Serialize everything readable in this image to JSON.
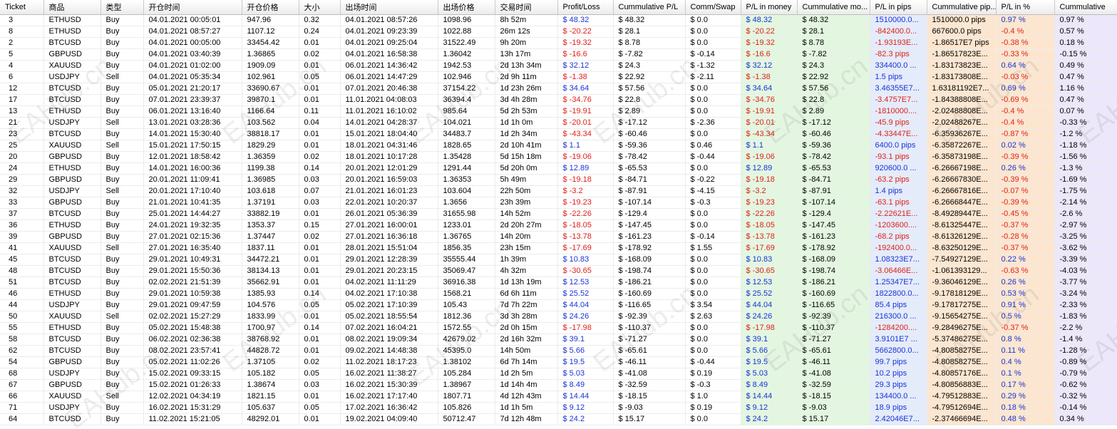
{
  "columns": [
    "Ticket",
    "商品",
    "类型",
    "开仓时间",
    "开仓价格",
    "大小",
    "出场时间",
    "出场价格",
    "交易时间",
    "Profit/Loss",
    "Cummulative P/L",
    "Comm/Swap",
    "P/L in money",
    "Cummulative mo...",
    "P/L in pips",
    "Cummulative pip...",
    "P/L in %",
    "Cummulative"
  ],
  "watermark": "EAHub.cn",
  "rows": [
    [
      "3",
      "ETHUSD",
      "Buy",
      "04.01.2021 00:05:01",
      "947.96",
      "0.32",
      "04.01.2021 08:57:26",
      "1098.96",
      "8h 52m",
      "$ 48.32",
      "$ 48.32",
      "$ 0.0",
      "$ 48.32",
      "$ 48.32",
      "1510000.0...",
      "1510000.0 pips",
      "0.97 %",
      "0.97 %"
    ],
    [
      "8",
      "ETHUSD",
      "Buy",
      "04.01.2021 08:57:27",
      "1107.12",
      "0.24",
      "04.01.2021 09:23:39",
      "1022.88",
      "26m 12s",
      "$ -20.22",
      "$ 28.1",
      "$ 0.0",
      "$ -20.22",
      "$ 28.1",
      "-842400.0...",
      "667600.0 pips",
      "-0.4 %",
      "0.57 %"
    ],
    [
      "2",
      "BTCUSD",
      "Buy",
      "04.01.2021 00:05:00",
      "33454.42",
      "0.01",
      "04.01.2021 09:25:04",
      "31522.49",
      "9h 20m",
      "$ -19.32",
      "$ 8.78",
      "$ 0.0",
      "$ -19.32",
      "$ 8.78",
      "-1.93193E...",
      "-1.86517E7 pips",
      "-0.38 %",
      "0.18 %"
    ],
    [
      "5",
      "GBPUSD",
      "Buy",
      "04.01.2021 03:40:39",
      "1.36865",
      "0.02",
      "04.01.2021 16:58:38",
      "1.36042",
      "13h 17m",
      "$ -16.6",
      "$ -7.82",
      "$ -0.14",
      "$ -16.6",
      "$ -7.82",
      "-82.3 pips",
      "-1.86517823E...",
      "-0.33 %",
      "-0.15 %"
    ],
    [
      "4",
      "XAUUSD",
      "Buy",
      "04.01.2021 01:02:00",
      "1909.09",
      "0.01",
      "06.01.2021 14:36:42",
      "1942.53",
      "2d 13h 34m",
      "$ 32.12",
      "$ 24.3",
      "$ -1.32",
      "$ 32.12",
      "$ 24.3",
      "334400.0 ...",
      "-1.83173823E...",
      "0.64 %",
      "0.49 %"
    ],
    [
      "6",
      "USDJPY",
      "Sell",
      "04.01.2021 05:35:34",
      "102.961",
      "0.05",
      "06.01.2021 14:47:29",
      "102.946",
      "2d 9h 11m",
      "$ -1.38",
      "$ 22.92",
      "$ -2.11",
      "$ -1.38",
      "$ 22.92",
      "1.5 pips",
      "-1.83173808E...",
      "-0.03 %",
      "0.47 %"
    ],
    [
      "12",
      "BTCUSD",
      "Buy",
      "05.01.2021 21:20:17",
      "33690.67",
      "0.01",
      "07.01.2021 20:46:38",
      "37154.22",
      "1d 23h 26m",
      "$ 34.64",
      "$ 57.56",
      "$ 0.0",
      "$ 34.64",
      "$ 57.56",
      "3.46355E7...",
      "1.63181192E7...",
      "0.69 %",
      "1.16 %"
    ],
    [
      "17",
      "BTCUSD",
      "Buy",
      "07.01.2021 23:39:37",
      "39870.1",
      "0.01",
      "11.01.2021 04:08:03",
      "36394.4",
      "3d 4h 28m",
      "$ -34.76",
      "$ 22.8",
      "$ 0.0",
      "$ -34.76",
      "$ 22.8",
      "-3.4757E7...",
      "-1.84388808E...",
      "-0.69 %",
      "0.47 %"
    ],
    [
      "13",
      "ETHUSD",
      "Buy",
      "06.01.2021 13:16:40",
      "1166.64",
      "0.11",
      "11.01.2021 16:10:02",
      "985.64",
      "5d 2h 53m",
      "$ -19.91",
      "$ 2.89",
      "$ 0.0",
      "$ -19.91",
      "$ 2.89",
      "-1810000....",
      "-2.02488808E...",
      "-0.4 %",
      "0.07 %"
    ],
    [
      "21",
      "USDJPY",
      "Sell",
      "13.01.2021 03:28:36",
      "103.562",
      "0.04",
      "14.01.2021 04:28:37",
      "104.021",
      "1d 1h 0m",
      "$ -20.01",
      "$ -17.12",
      "$ -2.36",
      "$ -20.01",
      "$ -17.12",
      "-45.9 pips",
      "-2.02488267E...",
      "-0.4 %",
      "-0.33 %"
    ],
    [
      "23",
      "BTCUSD",
      "Buy",
      "14.01.2021 15:30:40",
      "38818.17",
      "0.01",
      "15.01.2021 18:04:40",
      "34483.7",
      "1d 2h 34m",
      "$ -43.34",
      "$ -60.46",
      "$ 0.0",
      "$ -43.34",
      "$ -60.46",
      "-4.33447E...",
      "-6.35936267E...",
      "-0.87 %",
      "-1.2 %"
    ],
    [
      "25",
      "XAUUSD",
      "Sell",
      "15.01.2021 17:50:15",
      "1829.29",
      "0.01",
      "18.01.2021 04:31:46",
      "1828.65",
      "2d 10h 41m",
      "$ 1.1",
      "$ -59.36",
      "$ 0.46",
      "$ 1.1",
      "$ -59.36",
      "6400.0 pips",
      "-6.35872267E...",
      "0.02 %",
      "-1.18 %"
    ],
    [
      "20",
      "GBPUSD",
      "Buy",
      "12.01.2021 18:58:42",
      "1.36359",
      "0.02",
      "18.01.2021 10:17:28",
      "1.35428",
      "5d 15h 18m",
      "$ -19.06",
      "$ -78.42",
      "$ -0.44",
      "$ -19.06",
      "$ -78.42",
      "-93.1 pips",
      "-6.35873198E...",
      "-0.39 %",
      "-1.56 %"
    ],
    [
      "24",
      "ETHUSD",
      "Buy",
      "14.01.2021 16:00:36",
      "1199.38",
      "0.14",
      "20.01.2021 12:01:29",
      "1291.44",
      "5d 20h 0m",
      "$ 12.89",
      "$ -65.53",
      "$ 0.0",
      "$ 12.89",
      "$ -65.53",
      "920600.0 ...",
      "-6.26667198E...",
      "0.26 %",
      "-1.3 %"
    ],
    [
      "29",
      "GBPUSD",
      "Buy",
      "20.01.2021 11:09:41",
      "1.36985",
      "0.03",
      "20.01.2021 16:59:03",
      "1.36353",
      "5h 49m",
      "$ -19.18",
      "$ -84.71",
      "$ -0.22",
      "$ -19.18",
      "$ -84.71",
      "-63.2 pips",
      "-6.26667830E...",
      "-0.39 %",
      "-1.69 %"
    ],
    [
      "32",
      "USDJPY",
      "Sell",
      "20.01.2021 17:10:40",
      "103.618",
      "0.07",
      "21.01.2021 16:01:23",
      "103.604",
      "22h 50m",
      "$ -3.2",
      "$ -87.91",
      "$ -4.15",
      "$ -3.2",
      "$ -87.91",
      "1.4 pips",
      "-6.26667816E...",
      "-0.07 %",
      "-1.75 %"
    ],
    [
      "33",
      "GBPUSD",
      "Buy",
      "21.01.2021 10:41:35",
      "1.37191",
      "0.03",
      "22.01.2021 10:20:37",
      "1.3656",
      "23h 39m",
      "$ -19.23",
      "$ -107.14",
      "$ -0.3",
      "$ -19.23",
      "$ -107.14",
      "-63.1 pips",
      "-6.26668447E...",
      "-0.39 %",
      "-2.14 %"
    ],
    [
      "37",
      "BTCUSD",
      "Buy",
      "25.01.2021 14:44:27",
      "33882.19",
      "0.01",
      "26.01.2021 05:36:39",
      "31655.98",
      "14h 52m",
      "$ -22.26",
      "$ -129.4",
      "$ 0.0",
      "$ -22.26",
      "$ -129.4",
      "-2.22621E...",
      "-8.49289447E...",
      "-0.45 %",
      "-2.6 %"
    ],
    [
      "36",
      "ETHUSD",
      "Buy",
      "24.01.2021 19:32:35",
      "1353.37",
      "0.15",
      "27.01.2021 16:00:01",
      "1233.01",
      "2d 20h 27m",
      "$ -18.05",
      "$ -147.45",
      "$ 0.0",
      "$ -18.05",
      "$ -147.45",
      "-1203600....",
      "-8.61325447E...",
      "-0.37 %",
      "-2.97 %"
    ],
    [
      "39",
      "GBPUSD",
      "Buy",
      "27.01.2021 02:15:36",
      "1.37447",
      "0.02",
      "27.01.2021 16:36:18",
      "1.36765",
      "14h 20m",
      "$ -13.78",
      "$ -161.23",
      "$ -0.14",
      "$ -13.78",
      "$ -161.23",
      "-68.2 pips",
      "-8.61326129E...",
      "-0.28 %",
      "-3.25 %"
    ],
    [
      "41",
      "XAUUSD",
      "Sell",
      "27.01.2021 16:35:40",
      "1837.11",
      "0.01",
      "28.01.2021 15:51:04",
      "1856.35",
      "23h 15m",
      "$ -17.69",
      "$ -178.92",
      "$ 1.55",
      "$ -17.69",
      "$ -178.92",
      "-192400.0...",
      "-8.63250129E...",
      "-0.37 %",
      "-3.62 %"
    ],
    [
      "45",
      "BTCUSD",
      "Buy",
      "29.01.2021 10:49:31",
      "34472.21",
      "0.01",
      "29.01.2021 12:28:39",
      "35555.44",
      "1h 39m",
      "$ 10.83",
      "$ -168.09",
      "$ 0.0",
      "$ 10.83",
      "$ -168.09",
      "1.08323E7...",
      "-7.54927129E...",
      "0.22 %",
      "-3.39 %"
    ],
    [
      "48",
      "BTCUSD",
      "Buy",
      "29.01.2021 15:50:36",
      "38134.13",
      "0.01",
      "29.01.2021 20:23:15",
      "35069.47",
      "4h 32m",
      "$ -30.65",
      "$ -198.74",
      "$ 0.0",
      "$ -30.65",
      "$ -198.74",
      "-3.06466E...",
      "-1.061393129...",
      "-0.63 %",
      "-4.03 %"
    ],
    [
      "51",
      "BTCUSD",
      "Buy",
      "02.02.2021 21:51:39",
      "35662.91",
      "0.01",
      "04.02.2021 11:11:29",
      "36916.38",
      "1d 13h 19m",
      "$ 12.53",
      "$ -186.21",
      "$ 0.0",
      "$ 12.53",
      "$ -186.21",
      "1.25347E7...",
      "-9.36046129E...",
      "0.26 %",
      "-3.77 %"
    ],
    [
      "46",
      "ETHUSD",
      "Buy",
      "29.01.2021 10:59:38",
      "1385.93",
      "0.14",
      "04.02.2021 17:10:38",
      "1568.21",
      "6d 6h 11m",
      "$ 25.52",
      "$ -160.69",
      "$ 0.0",
      "$ 25.52",
      "$ -160.69",
      "1822800.0...",
      "-9.17818129E...",
      "0.53 %",
      "-3.24 %"
    ],
    [
      "44",
      "USDJPY",
      "Buy",
      "29.01.2021 09:47:59",
      "104.576",
      "0.05",
      "05.02.2021 17:10:39",
      "105.43",
      "7d 7h 22m",
      "$ 44.04",
      "$ -116.65",
      "$ 3.54",
      "$ 44.04",
      "$ -116.65",
      "85.4 pips",
      "-9.17817275E...",
      "0.91 %",
      "-2.33 %"
    ],
    [
      "50",
      "XAUUSD",
      "Sell",
      "02.02.2021 15:27:29",
      "1833.99",
      "0.01",
      "05.02.2021 18:55:54",
      "1812.36",
      "3d 3h 28m",
      "$ 24.26",
      "$ -92.39",
      "$ 2.63",
      "$ 24.26",
      "$ -92.39",
      "216300.0 ...",
      "-9.15654275E...",
      "0.5 %",
      "-1.83 %"
    ],
    [
      "55",
      "ETHUSD",
      "Buy",
      "05.02.2021 15:48:38",
      "1700.97",
      "0.14",
      "07.02.2021 16:04:21",
      "1572.55",
      "2d 0h 15m",
      "$ -17.98",
      "$ -110.37",
      "$ 0.0",
      "$ -17.98",
      "$ -110.37",
      "-1284200....",
      "-9.28496275E...",
      "-0.37 %",
      "-2.2 %"
    ],
    [
      "58",
      "BTCUSD",
      "Buy",
      "06.02.2021 02:36:38",
      "38768.92",
      "0.01",
      "08.02.2021 19:09:34",
      "42679.02",
      "2d 16h 32m",
      "$ 39.1",
      "$ -71.27",
      "$ 0.0",
      "$ 39.1",
      "$ -71.27",
      "3.9101E7 ...",
      "-5.37486275E...",
      "0.8 %",
      "-1.4 %"
    ],
    [
      "62",
      "BTCUSD",
      "Buy",
      "08.02.2021 23:57:41",
      "44828.72",
      "0.01",
      "09.02.2021 14:48:38",
      "45395.0",
      "14h 50m",
      "$ 5.66",
      "$ -65.61",
      "$ 0.0",
      "$ 5.66",
      "$ -65.61",
      "5662800.0...",
      "-4.80858275E...",
      "0.11 %",
      "-1.28 %"
    ],
    [
      "54",
      "GBPUSD",
      "Buy",
      "05.02.2021 11:02:26",
      "1.37105",
      "0.02",
      "11.02.2021 18:17:23",
      "1.38102",
      "6d 7h 14m",
      "$ 19.5",
      "$ -46.11",
      "$ -0.44",
      "$ 19.5",
      "$ -46.11",
      "99.7 pips",
      "-4.80858275E...",
      "0.4 %",
      "-0.89 %"
    ],
    [
      "68",
      "USDJPY",
      "Buy",
      "15.02.2021 09:33:15",
      "105.182",
      "0.05",
      "16.02.2021 11:38:27",
      "105.284",
      "1d 2h 5m",
      "$ 5.03",
      "$ -41.08",
      "$ 0.19",
      "$ 5.03",
      "$ -41.08",
      "10.2 pips",
      "-4.80857176E...",
      "0.1 %",
      "-0.79 %"
    ],
    [
      "67",
      "GBPUSD",
      "Buy",
      "15.02.2021 01:26:33",
      "1.38674",
      "0.03",
      "16.02.2021 15:30:39",
      "1.38967",
      "1d 14h 4m",
      "$ 8.49",
      "$ -32.59",
      "$ -0.3",
      "$ 8.49",
      "$ -32.59",
      "29.3 pips",
      "-4.80856883E...",
      "0.17 %",
      "-0.62 %"
    ],
    [
      "66",
      "XAUUSD",
      "Sell",
      "12.02.2021 04:34:19",
      "1821.15",
      "0.01",
      "16.02.2021 17:17:40",
      "1807.71",
      "4d 12h 43m",
      "$ 14.44",
      "$ -18.15",
      "$ 1.0",
      "$ 14.44",
      "$ -18.15",
      "134400.0 ...",
      "-4.79512883E...",
      "0.29 %",
      "-0.32 %"
    ],
    [
      "71",
      "USDJPY",
      "Buy",
      "16.02.2021 15:31:29",
      "105.637",
      "0.05",
      "17.02.2021 16:36:42",
      "105.826",
      "1d 1h 5m",
      "$ 9.12",
      "$ -9.03",
      "$ 0.19",
      "$ 9.12",
      "$ -9.03",
      "18.9 pips",
      "-4.79512694E...",
      "0.18 %",
      "-0.14 %"
    ],
    [
      "64",
      "BTCUSD",
      "Buy",
      "11.02.2021 15:21:05",
      "48292.01",
      "0.01",
      "19.02.2021 04:09:40",
      "50712.47",
      "7d 12h 48m",
      "$ 24.2",
      "$ 15.17",
      "$ 0.0",
      "$ 24.2",
      "$ 15.17",
      "2.42046E7...",
      "-2.37466694E...",
      "0.48 %",
      "0.34 %"
    ]
  ]
}
